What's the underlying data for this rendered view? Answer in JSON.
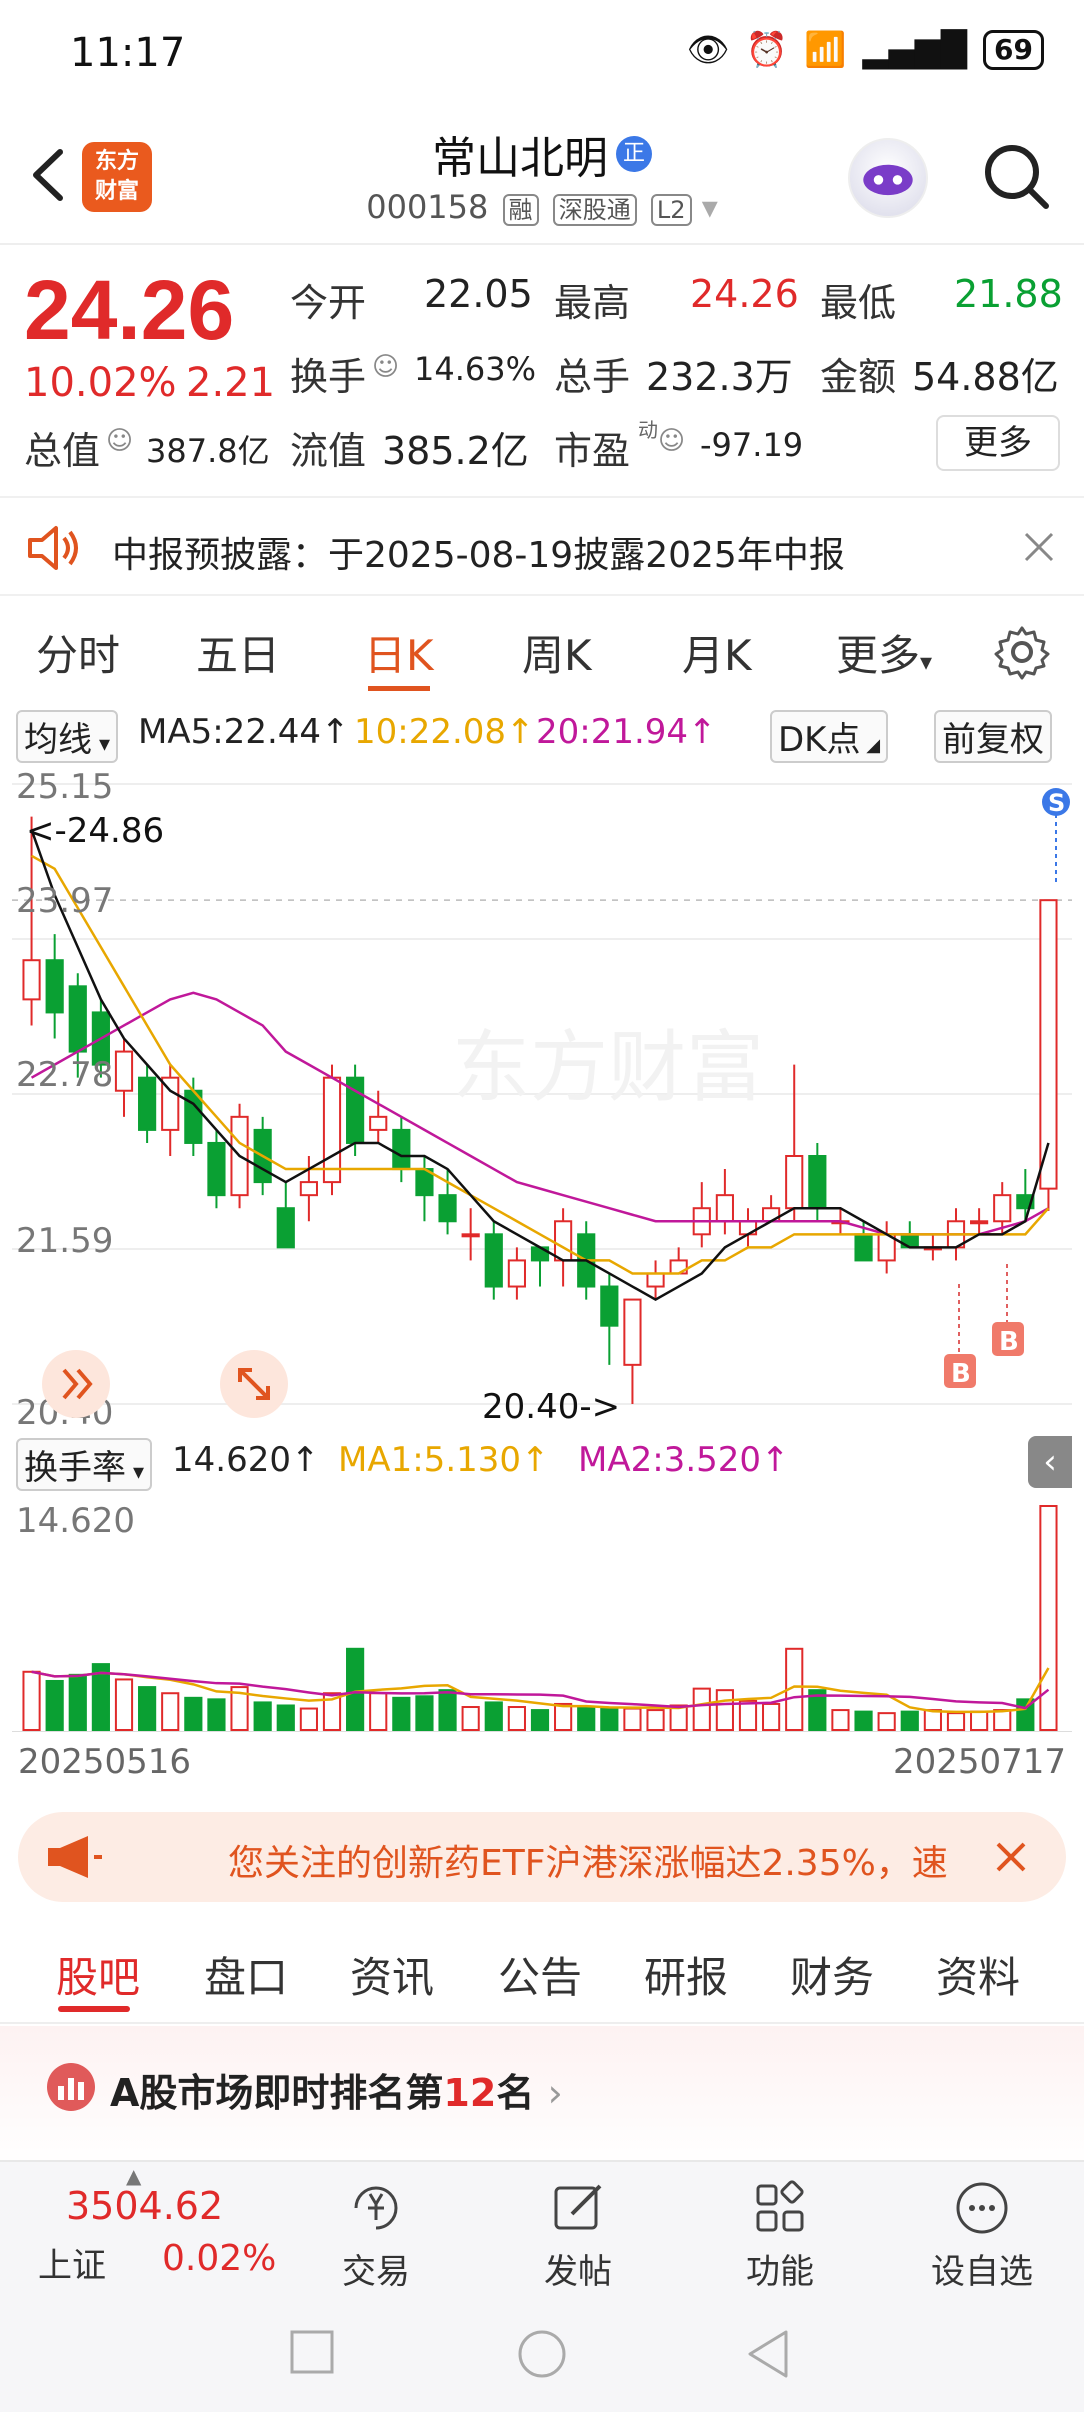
{
  "status_bar": {
    "time": "11:17",
    "battery": "69"
  },
  "header": {
    "app_logo": "东方\n财富",
    "stock_name": "常山北明",
    "stock_badge": "正",
    "stock_code": "000158",
    "tags": [
      "融",
      "深股通",
      "L2"
    ]
  },
  "quote": {
    "price": "24.26",
    "change_pct": "10.02%",
    "change_amt": "2.21",
    "open_label": "今开",
    "open": "22.05",
    "high_label": "最高",
    "high": "24.26",
    "low_label": "最低",
    "low": "21.88",
    "turnover_label": "换手",
    "turnover": "14.63%",
    "volume_label": "总手",
    "volume": "232.3万",
    "amount_label": "金额",
    "amount": "54.88亿",
    "mktcap_label": "总值",
    "mktcap": "387.8亿",
    "float_label": "流值",
    "float": "385.2亿",
    "pe_label": "市盈",
    "pe_sup": "动",
    "pe": "-97.19",
    "more": "更多"
  },
  "notice": {
    "text": "中报预披露：于2025-08-19披露2025年中报"
  },
  "chart_tabs": [
    "分时",
    "五日",
    "日K",
    "周K",
    "月K",
    "更多"
  ],
  "ma_row": {
    "selector": "均线",
    "ma5": "MA5:22.44↑",
    "ma10": "10:22.08↑",
    "ma20": "20:21.94↑",
    "dk": "DK点",
    "adjust": "前复权"
  },
  "colors": {
    "up": "#e02a2a",
    "down": "#0aa033",
    "ma5": "#111111",
    "ma10": "#e8a700",
    "ma20": "#c0189a",
    "accent": "#e0541f"
  },
  "chart_data": {
    "type": "candlestick",
    "y_ticks": [
      "25.15",
      "23.97",
      "22.78",
      "21.59",
      "20.40"
    ],
    "ylim": [
      20.4,
      25.15
    ],
    "annotations": {
      "high_marker": "<-24.86",
      "low_marker": "20.40->",
      "buy_marks": [
        "B",
        "B"
      ]
    },
    "x_start": "20250516",
    "x_end": "20250717",
    "candles": [
      [
        23.5,
        23.8,
        24.9,
        23.3
      ],
      [
        23.8,
        23.4,
        24.0,
        23.2
      ],
      [
        23.6,
        23.1,
        23.7,
        22.9
      ],
      [
        23.4,
        23.0,
        23.5,
        22.9
      ],
      [
        22.8,
        23.1,
        23.2,
        22.6
      ],
      [
        22.9,
        22.5,
        23.0,
        22.4
      ],
      [
        22.5,
        22.9,
        23.0,
        22.3
      ],
      [
        22.8,
        22.4,
        22.9,
        22.3
      ],
      [
        22.4,
        22.0,
        22.5,
        21.9
      ],
      [
        22.0,
        22.6,
        22.7,
        21.9
      ],
      [
        22.5,
        22.1,
        22.6,
        22.0
      ],
      [
        21.9,
        21.6,
        22.1,
        21.6
      ],
      [
        22.0,
        22.1,
        22.3,
        21.8
      ],
      [
        22.1,
        22.9,
        23.0,
        22.0
      ],
      [
        22.9,
        22.4,
        23.0,
        22.3
      ],
      [
        22.5,
        22.6,
        22.8,
        22.4
      ],
      [
        22.5,
        22.2,
        22.6,
        22.1
      ],
      [
        22.2,
        22.0,
        22.3,
        21.8
      ],
      [
        22.0,
        21.8,
        22.2,
        21.7
      ],
      [
        21.7,
        21.7,
        21.9,
        21.5
      ],
      [
        21.7,
        21.3,
        21.8,
        21.2
      ],
      [
        21.3,
        21.5,
        21.6,
        21.2
      ],
      [
        21.6,
        21.5,
        21.6,
        21.3
      ],
      [
        21.5,
        21.8,
        21.9,
        21.3
      ],
      [
        21.7,
        21.3,
        21.8,
        21.2
      ],
      [
        21.3,
        21.0,
        21.4,
        20.7
      ],
      [
        20.7,
        21.2,
        21.2,
        20.4
      ],
      [
        21.3,
        21.4,
        21.5,
        21.2
      ],
      [
        21.4,
        21.5,
        21.6,
        21.4
      ],
      [
        21.7,
        21.9,
        22.1,
        21.6
      ],
      [
        21.8,
        22.0,
        22.2,
        21.7
      ],
      [
        21.7,
        21.8,
        21.9,
        21.6
      ],
      [
        21.8,
        21.9,
        22.0,
        21.8
      ],
      [
        21.9,
        22.3,
        23.0,
        21.8
      ],
      [
        22.3,
        21.9,
        22.4,
        21.8
      ],
      [
        21.8,
        21.8,
        21.9,
        21.7
      ],
      [
        21.7,
        21.5,
        21.8,
        21.5
      ],
      [
        21.5,
        21.7,
        21.8,
        21.4
      ],
      [
        21.7,
        21.6,
        21.8,
        21.6
      ],
      [
        21.6,
        21.6,
        21.7,
        21.5
      ],
      [
        21.6,
        21.8,
        21.9,
        21.5
      ],
      [
        21.8,
        21.8,
        21.9,
        21.7
      ],
      [
        21.8,
        22.0,
        22.1,
        21.7
      ],
      [
        22.0,
        21.9,
        22.2,
        21.8
      ],
      [
        22.05,
        24.26,
        24.26,
        21.88
      ]
    ],
    "ma5": [
      24.8,
      24.3,
      23.9,
      23.5,
      23.2,
      23.0,
      22.8,
      22.7,
      22.5,
      22.3,
      22.2,
      22.1,
      22.2,
      22.3,
      22.4,
      22.4,
      22.3,
      22.3,
      22.2,
      22.0,
      21.8,
      21.7,
      21.6,
      21.5,
      21.5,
      21.4,
      21.3,
      21.2,
      21.3,
      21.4,
      21.6,
      21.7,
      21.8,
      21.9,
      21.9,
      21.9,
      21.8,
      21.7,
      21.6,
      21.6,
      21.6,
      21.7,
      21.7,
      21.8,
      22.4
    ],
    "ma10": [
      24.6,
      24.5,
      24.2,
      23.9,
      23.6,
      23.3,
      23.0,
      22.8,
      22.6,
      22.4,
      22.3,
      22.2,
      22.2,
      22.2,
      22.2,
      22.2,
      22.2,
      22.2,
      22.1,
      22.0,
      21.9,
      21.8,
      21.7,
      21.6,
      21.5,
      21.5,
      21.4,
      21.4,
      21.4,
      21.5,
      21.5,
      21.6,
      21.6,
      21.7,
      21.7,
      21.7,
      21.7,
      21.7,
      21.7,
      21.7,
      21.7,
      21.7,
      21.7,
      21.7,
      21.9
    ],
    "ma20": [
      22.9,
      23.0,
      23.1,
      23.2,
      23.3,
      23.4,
      23.5,
      23.55,
      23.5,
      23.4,
      23.3,
      23.1,
      23.0,
      22.9,
      22.8,
      22.7,
      22.6,
      22.5,
      22.4,
      22.3,
      22.2,
      22.1,
      22.05,
      22.0,
      21.95,
      21.9,
      21.85,
      21.8,
      21.8,
      21.8,
      21.8,
      21.8,
      21.8,
      21.8,
      21.8,
      21.8,
      21.75,
      21.7,
      21.7,
      21.7,
      21.7,
      21.7,
      21.75,
      21.8,
      21.9
    ]
  },
  "vol_header": {
    "selector": "换手率",
    "value": "14.620↑",
    "ma1": "MA1:5.130↑",
    "ma2": "MA2:3.520↑"
  },
  "vol_data": {
    "max_label": "14.620",
    "max": 14.62,
    "values": [
      3.8,
      3.2,
      3.6,
      4.3,
      3.3,
      2.8,
      2.4,
      2.1,
      2.0,
      2.8,
      1.8,
      1.6,
      1.4,
      2.4,
      5.3,
      2.4,
      2.1,
      2.2,
      2.6,
      1.5,
      1.8,
      1.5,
      1.3,
      1.7,
      1.5,
      1.4,
      1.4,
      1.3,
      1.6,
      2.7,
      2.6,
      1.9,
      1.7,
      5.3,
      2.6,
      1.3,
      1.2,
      1.1,
      1.2,
      1.3,
      1.1,
      1.2,
      1.3,
      2.0,
      14.62
    ]
  },
  "promo": {
    "text": "您关注的创新药ETF沪港深涨幅达2.35%，速"
  },
  "content_tabs": [
    "股吧",
    "盘口",
    "资讯",
    "公告",
    "研报",
    "财务",
    "资料"
  ],
  "rank": {
    "prefix": "A股市场即时排名第",
    "rank": "12",
    "suffix": "名"
  },
  "bottom_bar": {
    "index_value": "3504.62",
    "index_name": "上证",
    "index_change": "0.02%",
    "items": [
      "交易",
      "发帖",
      "功能",
      "设自选"
    ]
  }
}
